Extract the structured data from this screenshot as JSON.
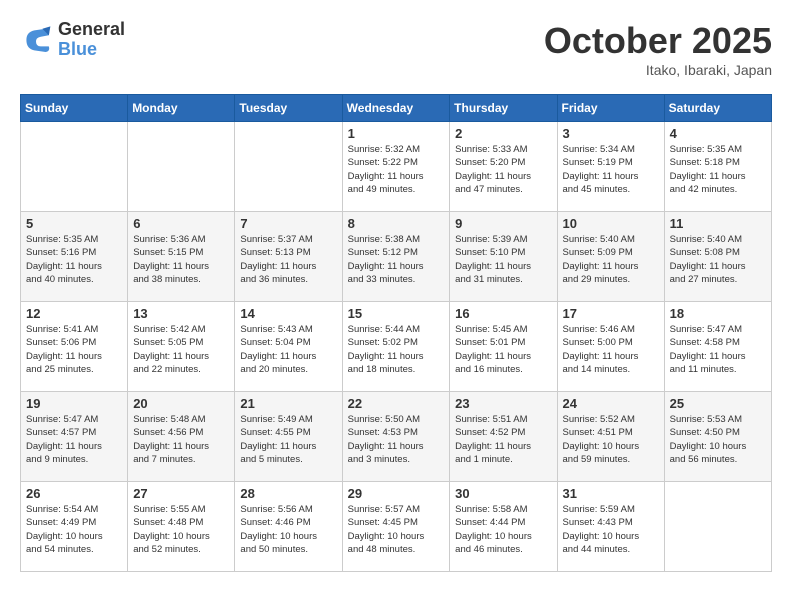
{
  "logo": {
    "line1": "General",
    "line2": "Blue"
  },
  "title": "October 2025",
  "location": "Itako, Ibaraki, Japan",
  "weekdays": [
    "Sunday",
    "Monday",
    "Tuesday",
    "Wednesday",
    "Thursday",
    "Friday",
    "Saturday"
  ],
  "weeks": [
    [
      {
        "day": "",
        "info": ""
      },
      {
        "day": "",
        "info": ""
      },
      {
        "day": "",
        "info": ""
      },
      {
        "day": "1",
        "info": "Sunrise: 5:32 AM\nSunset: 5:22 PM\nDaylight: 11 hours\nand 49 minutes."
      },
      {
        "day": "2",
        "info": "Sunrise: 5:33 AM\nSunset: 5:20 PM\nDaylight: 11 hours\nand 47 minutes."
      },
      {
        "day": "3",
        "info": "Sunrise: 5:34 AM\nSunset: 5:19 PM\nDaylight: 11 hours\nand 45 minutes."
      },
      {
        "day": "4",
        "info": "Sunrise: 5:35 AM\nSunset: 5:18 PM\nDaylight: 11 hours\nand 42 minutes."
      }
    ],
    [
      {
        "day": "5",
        "info": "Sunrise: 5:35 AM\nSunset: 5:16 PM\nDaylight: 11 hours\nand 40 minutes."
      },
      {
        "day": "6",
        "info": "Sunrise: 5:36 AM\nSunset: 5:15 PM\nDaylight: 11 hours\nand 38 minutes."
      },
      {
        "day": "7",
        "info": "Sunrise: 5:37 AM\nSunset: 5:13 PM\nDaylight: 11 hours\nand 36 minutes."
      },
      {
        "day": "8",
        "info": "Sunrise: 5:38 AM\nSunset: 5:12 PM\nDaylight: 11 hours\nand 33 minutes."
      },
      {
        "day": "9",
        "info": "Sunrise: 5:39 AM\nSunset: 5:10 PM\nDaylight: 11 hours\nand 31 minutes."
      },
      {
        "day": "10",
        "info": "Sunrise: 5:40 AM\nSunset: 5:09 PM\nDaylight: 11 hours\nand 29 minutes."
      },
      {
        "day": "11",
        "info": "Sunrise: 5:40 AM\nSunset: 5:08 PM\nDaylight: 11 hours\nand 27 minutes."
      }
    ],
    [
      {
        "day": "12",
        "info": "Sunrise: 5:41 AM\nSunset: 5:06 PM\nDaylight: 11 hours\nand 25 minutes."
      },
      {
        "day": "13",
        "info": "Sunrise: 5:42 AM\nSunset: 5:05 PM\nDaylight: 11 hours\nand 22 minutes."
      },
      {
        "day": "14",
        "info": "Sunrise: 5:43 AM\nSunset: 5:04 PM\nDaylight: 11 hours\nand 20 minutes."
      },
      {
        "day": "15",
        "info": "Sunrise: 5:44 AM\nSunset: 5:02 PM\nDaylight: 11 hours\nand 18 minutes."
      },
      {
        "day": "16",
        "info": "Sunrise: 5:45 AM\nSunset: 5:01 PM\nDaylight: 11 hours\nand 16 minutes."
      },
      {
        "day": "17",
        "info": "Sunrise: 5:46 AM\nSunset: 5:00 PM\nDaylight: 11 hours\nand 14 minutes."
      },
      {
        "day": "18",
        "info": "Sunrise: 5:47 AM\nSunset: 4:58 PM\nDaylight: 11 hours\nand 11 minutes."
      }
    ],
    [
      {
        "day": "19",
        "info": "Sunrise: 5:47 AM\nSunset: 4:57 PM\nDaylight: 11 hours\nand 9 minutes."
      },
      {
        "day": "20",
        "info": "Sunrise: 5:48 AM\nSunset: 4:56 PM\nDaylight: 11 hours\nand 7 minutes."
      },
      {
        "day": "21",
        "info": "Sunrise: 5:49 AM\nSunset: 4:55 PM\nDaylight: 11 hours\nand 5 minutes."
      },
      {
        "day": "22",
        "info": "Sunrise: 5:50 AM\nSunset: 4:53 PM\nDaylight: 11 hours\nand 3 minutes."
      },
      {
        "day": "23",
        "info": "Sunrise: 5:51 AM\nSunset: 4:52 PM\nDaylight: 11 hours\nand 1 minute."
      },
      {
        "day": "24",
        "info": "Sunrise: 5:52 AM\nSunset: 4:51 PM\nDaylight: 10 hours\nand 59 minutes."
      },
      {
        "day": "25",
        "info": "Sunrise: 5:53 AM\nSunset: 4:50 PM\nDaylight: 10 hours\nand 56 minutes."
      }
    ],
    [
      {
        "day": "26",
        "info": "Sunrise: 5:54 AM\nSunset: 4:49 PM\nDaylight: 10 hours\nand 54 minutes."
      },
      {
        "day": "27",
        "info": "Sunrise: 5:55 AM\nSunset: 4:48 PM\nDaylight: 10 hours\nand 52 minutes."
      },
      {
        "day": "28",
        "info": "Sunrise: 5:56 AM\nSunset: 4:46 PM\nDaylight: 10 hours\nand 50 minutes."
      },
      {
        "day": "29",
        "info": "Sunrise: 5:57 AM\nSunset: 4:45 PM\nDaylight: 10 hours\nand 48 minutes."
      },
      {
        "day": "30",
        "info": "Sunrise: 5:58 AM\nSunset: 4:44 PM\nDaylight: 10 hours\nand 46 minutes."
      },
      {
        "day": "31",
        "info": "Sunrise: 5:59 AM\nSunset: 4:43 PM\nDaylight: 10 hours\nand 44 minutes."
      },
      {
        "day": "",
        "info": ""
      }
    ]
  ]
}
